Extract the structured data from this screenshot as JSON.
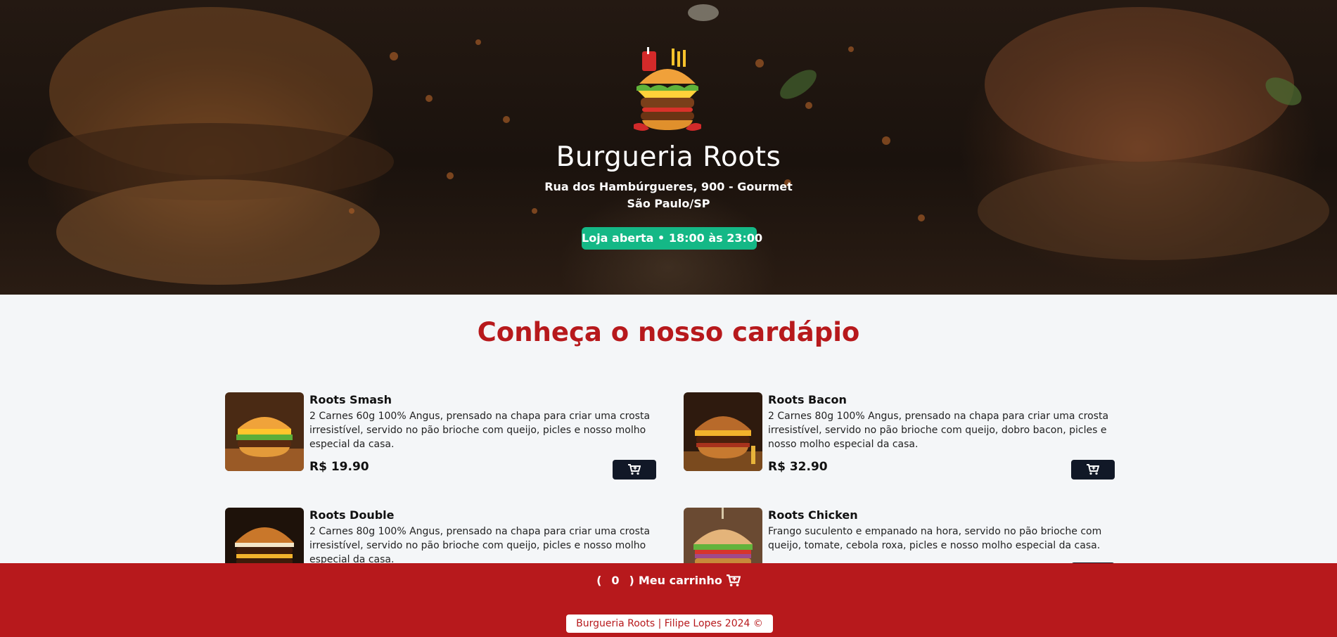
{
  "hero": {
    "title": "Burgueria Roots",
    "address_line1": "Rua dos Hambúrgueres, 900 - Gourmet",
    "address_line2": "São Paulo/SP",
    "status": "Loja aberta • 18:00 às 23:00",
    "logo_icon": "burger-logo-icon"
  },
  "menu": {
    "title": "Conheça o nosso cardápio",
    "items": [
      {
        "name": "Roots Smash",
        "description": "2 Carnes 60g 100% Angus, prensado na chapa para criar uma crosta irresistível, servido no pão brioche com queijo, picles e nosso molho especial da casa.",
        "price": "R$ 19.90"
      },
      {
        "name": "Roots Bacon",
        "description": "2 Carnes 80g 100% Angus, prensado na chapa para criar uma crosta irresistível, servido no pão brioche com queijo, dobro bacon, picles e nosso molho especial da casa.",
        "price": "R$ 32.90"
      },
      {
        "name": "Roots Double",
        "description": "2 Carnes 80g 100% Angus, prensado na chapa para criar uma crosta irresistível, servido no pão brioche com queijo, picles e nosso molho especial da casa.",
        "price": ""
      },
      {
        "name": "Roots Chicken",
        "description": "Frango suculento e empanado na hora, servido no pão brioche com queijo, tomate, cebola roxa, picles e nosso molho especial da casa.",
        "price": ""
      }
    ]
  },
  "footer": {
    "cart_open": "(",
    "cart_count": "0",
    "cart_close": ")",
    "cart_label": "Meu carrinho",
    "credit": "Burgueria Roots | Filipe Lopes 2024 ©"
  },
  "colors": {
    "brand_red": "#b7191c",
    "open_green": "#14b886",
    "button_dark": "#111827",
    "page_bg": "#f4f6f8"
  }
}
